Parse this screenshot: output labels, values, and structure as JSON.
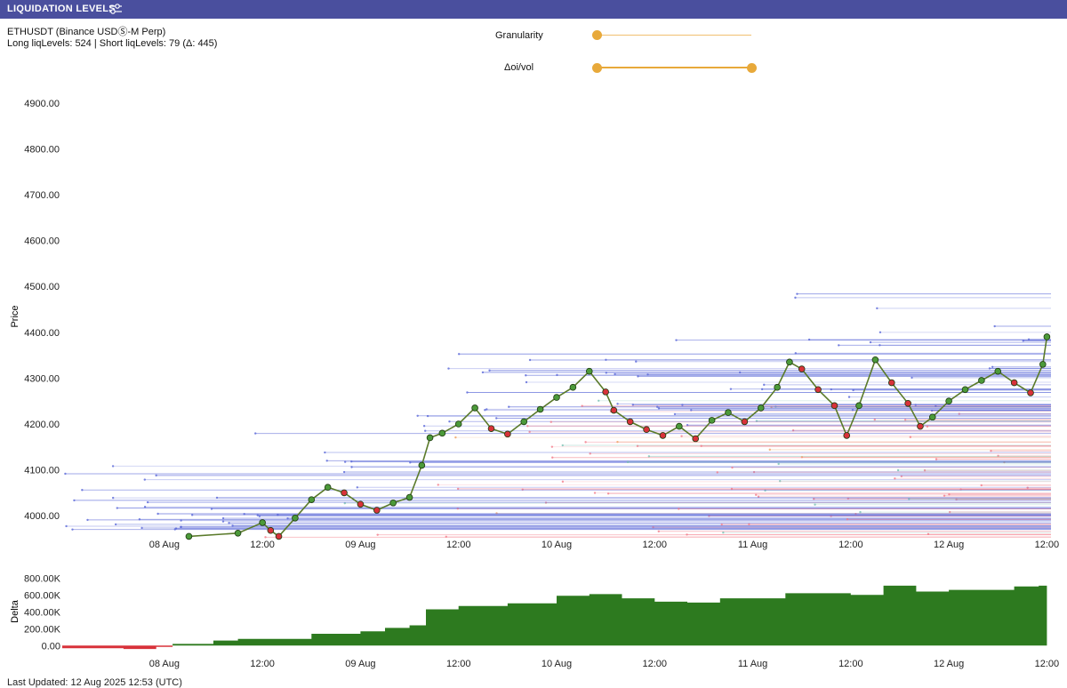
{
  "header": {
    "title": "LIQUIDATION LEVELS",
    "settings_icon": "sliders-icon",
    "bar_color": "#4a4f9e"
  },
  "info": {
    "symbol": "ETHUSDT (Binance USDⓈ-M Perp)",
    "levels": "Long liqLevels: 524 | Short liqLevels: 79 (Δ: 445)"
  },
  "controls": {
    "granularity_label": "Granularity",
    "granularity_value": 0.0,
    "oivol_label": "Δoi/vol",
    "oivol_range": [
      0.0,
      1.0
    ],
    "accent": "#e8a93a"
  },
  "chart_data": [
    {
      "type": "line",
      "ylabel": "Price",
      "yticks": [
        "4000.00",
        "4100.00",
        "4200.00",
        "4300.00",
        "4400.00",
        "4500.00",
        "4600.00",
        "4700.00",
        "4800.00",
        "4900.00"
      ],
      "ylim": [
        3950,
        4950
      ],
      "xticks": [
        "08 Aug",
        "12:00",
        "09 Aug",
        "12:00",
        "10 Aug",
        "12:00",
        "11 Aug",
        "12:00",
        "12 Aug",
        "12:00"
      ],
      "x_unit": "hours from 08 Aug 00:00",
      "xlim": [
        -12.5,
        108.5
      ],
      "series": [
        {
          "values": [
            [
              3,
              3955
            ],
            [
              9,
              3962
            ],
            [
              12,
              3985
            ],
            [
              13,
              3968
            ],
            [
              14,
              3955
            ],
            [
              16,
              3995
            ],
            [
              18,
              4035
            ],
            [
              20,
              4062
            ],
            [
              22,
              4050
            ],
            [
              24,
              4025
            ],
            [
              26,
              4012
            ],
            [
              28,
              4028
            ],
            [
              30,
              4040
            ],
            [
              31.5,
              4110
            ],
            [
              32.5,
              4170
            ],
            [
              34,
              4180
            ],
            [
              36,
              4200
            ],
            [
              38,
              4235
            ],
            [
              40,
              4190
            ],
            [
              42,
              4178
            ],
            [
              44,
              4205
            ],
            [
              46,
              4232
            ],
            [
              48,
              4258
            ],
            [
              50,
              4280
            ],
            [
              52,
              4315
            ],
            [
              54,
              4270
            ],
            [
              55,
              4230
            ],
            [
              57,
              4205
            ],
            [
              59,
              4188
            ],
            [
              61,
              4175
            ],
            [
              63,
              4195
            ],
            [
              65,
              4168
            ],
            [
              67,
              4208
            ],
            [
              69,
              4225
            ],
            [
              71,
              4205
            ],
            [
              73,
              4235
            ],
            [
              75,
              4280
            ],
            [
              76.5,
              4335
            ],
            [
              78,
              4320
            ],
            [
              80,
              4275
            ],
            [
              82,
              4240
            ],
            [
              83.5,
              4175
            ],
            [
              85,
              4240
            ],
            [
              87,
              4340
            ],
            [
              89,
              4290
            ],
            [
              91,
              4245
            ],
            [
              92.5,
              4195
            ],
            [
              94,
              4215
            ],
            [
              96,
              4250
            ],
            [
              98,
              4275
            ],
            [
              100,
              4295
            ],
            [
              102,
              4315
            ],
            [
              104,
              4290
            ],
            [
              106,
              4268
            ],
            [
              107.5,
              4330
            ],
            [
              108,
              4390
            ]
          ],
          "color": "#5a7a2a"
        }
      ],
      "marker_colors": {
        "up": "#4c9a3a",
        "down": "#d8323a"
      },
      "short_level_color": "#5a68d8",
      "long_level_color": "#f27a88",
      "secondary_level_color": "#79c0b3",
      "grid": false
    },
    {
      "type": "area",
      "ylabel": "Delta",
      "yticks": [
        "0.00",
        "200.00K",
        "400.00K",
        "600.00K",
        "800.00K"
      ],
      "ylim": [
        -60000,
        930000
      ],
      "xticks": [
        "08 Aug",
        "12:00",
        "09 Aug",
        "12:00",
        "10 Aug",
        "12:00",
        "11 Aug",
        "12:00",
        "12 Aug",
        "12:00"
      ],
      "values": [
        [
          -12.5,
          -30000
        ],
        [
          -5,
          -40000
        ],
        [
          -1,
          -15000
        ],
        [
          1,
          20000
        ],
        [
          6,
          60000
        ],
        [
          9,
          80000
        ],
        [
          12,
          80000
        ],
        [
          18,
          140000
        ],
        [
          24,
          170000
        ],
        [
          27,
          210000
        ],
        [
          30,
          240000
        ],
        [
          32,
          430000
        ],
        [
          36,
          470000
        ],
        [
          42,
          500000
        ],
        [
          48,
          590000
        ],
        [
          52,
          610000
        ],
        [
          56,
          560000
        ],
        [
          60,
          520000
        ],
        [
          64,
          510000
        ],
        [
          68,
          560000
        ],
        [
          72,
          560000
        ],
        [
          76,
          620000
        ],
        [
          80,
          620000
        ],
        [
          84,
          600000
        ],
        [
          88,
          710000
        ],
        [
          92,
          640000
        ],
        [
          96,
          660000
        ],
        [
          100,
          660000
        ],
        [
          104,
          700000
        ],
        [
          107,
          710000
        ],
        [
          108,
          900000
        ]
      ],
      "positive_color": "#2d7a1f",
      "negative_color": "#d8323a",
      "grid": false
    }
  ],
  "footer": {
    "last_updated": "Last Updated: 12 Aug 2025 12:53 (UTC)"
  }
}
